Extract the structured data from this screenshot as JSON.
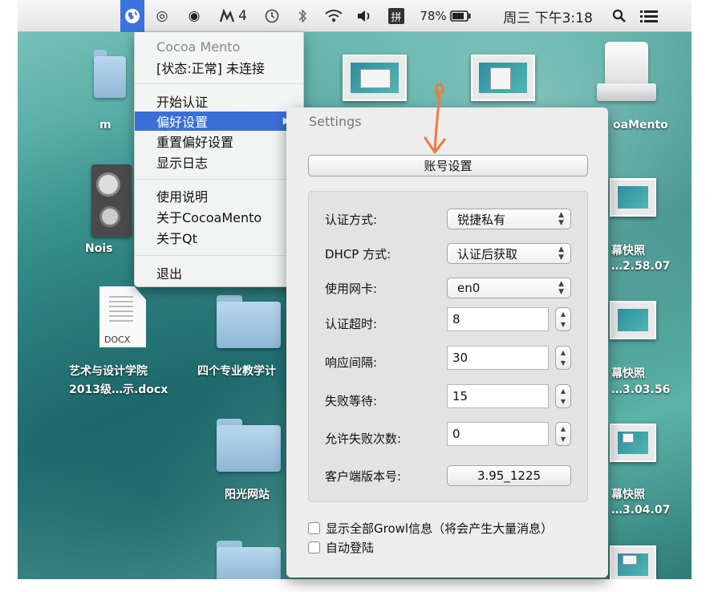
{
  "menubar": {
    "app_icon": "globe-icon",
    "items": [
      "◎",
      "◉",
      "4"
    ],
    "battery_percent": "78%",
    "datetime": "周三 下午3:18",
    "icons": [
      "time-machine-icon",
      "bluetooth-icon",
      "wifi-icon",
      "volume-icon",
      "input-method-icon",
      "battery-icon",
      "spotlight-icon",
      "notification-list-icon"
    ]
  },
  "menu": {
    "app_name": "Cocoa Mento",
    "status": "[状态:正常] 未连接",
    "items": [
      "开始认证",
      "偏好设置",
      "重置偏好设置",
      "显示日志",
      "使用说明",
      "关于CocoaMento",
      "关于Qt",
      "退出"
    ],
    "selected": "偏好设置",
    "submenu_arrow": "▶"
  },
  "desktop": {
    "labels": {
      "left_top": "m",
      "noise": "Nois",
      "docx_badge": "DOCX",
      "docx_line1": "艺术与设计学院",
      "docx_line2": "2013级…示.docx",
      "folder_four": "四个专业教学计",
      "folder_sun": "阳光网站",
      "drive": "oaMento",
      "shot1_line1": "幕快照",
      "shot1_line2": "…2.58.07",
      "shot2_line1": "幕快照",
      "shot2_line2": "…3.03.56",
      "shot3_line1": "幕快照",
      "shot3_line2": "…3.04.07"
    }
  },
  "settings": {
    "title": "Settings",
    "account_button": "账号设置",
    "fields": [
      {
        "label": "认证方式:",
        "kind": "popup",
        "value": "锐捷私有"
      },
      {
        "label": "DHCP 方式:",
        "kind": "popup",
        "value": "认证后获取"
      },
      {
        "label": "使用网卡:",
        "kind": "popup",
        "value": "en0"
      },
      {
        "label": "认证超时:",
        "kind": "stepper",
        "value": "8"
      },
      {
        "label": "响应间隔:",
        "kind": "stepper",
        "value": "30"
      },
      {
        "label": "失败等待:",
        "kind": "stepper",
        "value": "15"
      },
      {
        "label": "允许失败次数:",
        "kind": "stepper",
        "value": "0"
      }
    ],
    "version_label": "客户端版本号:",
    "version_value": "3.95_1225",
    "checkboxes": [
      {
        "label": "显示全部Growl信息（将会产生大量消息）",
        "checked": false
      },
      {
        "label": "自动登陆",
        "checked": false
      }
    ]
  },
  "colors": {
    "menu_selection": "#3b6fd8",
    "annotation_arrow": "#f07a3c"
  }
}
